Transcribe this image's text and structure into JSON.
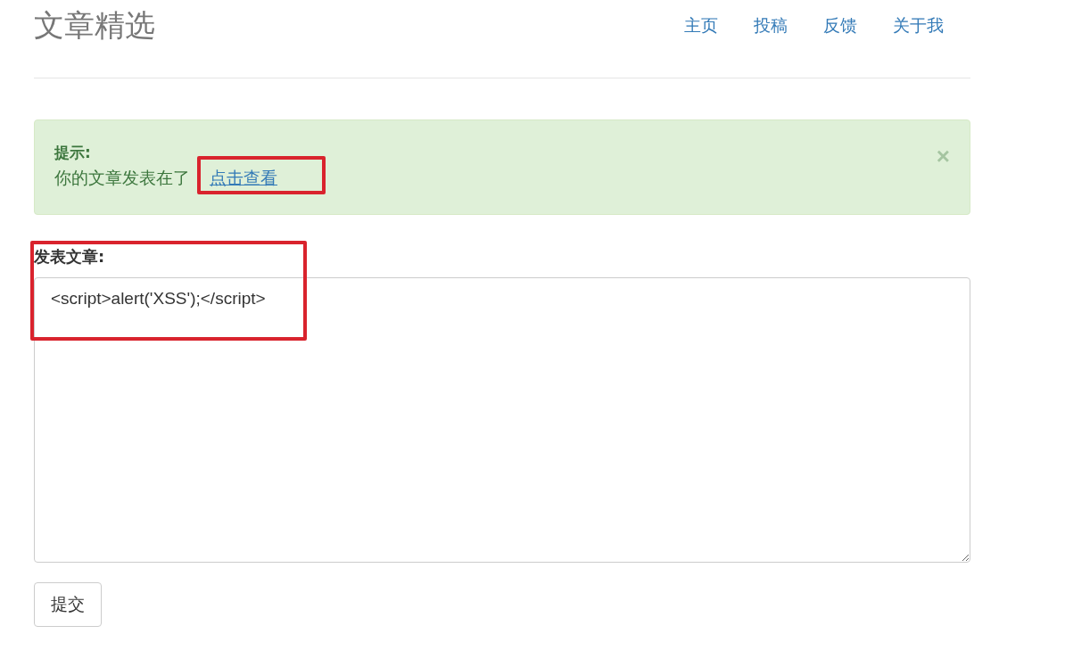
{
  "header": {
    "title": "文章精选",
    "nav": [
      {
        "label": "主页"
      },
      {
        "label": "投稿"
      },
      {
        "label": "反馈"
      },
      {
        "label": "关于我"
      }
    ]
  },
  "alert": {
    "heading": "提示:",
    "message": "你的文章发表在了",
    "link": "点击查看",
    "close": "×"
  },
  "form": {
    "label": "发表文章:",
    "value": "<script>alert('XSS');</script>",
    "submit": "提交"
  }
}
